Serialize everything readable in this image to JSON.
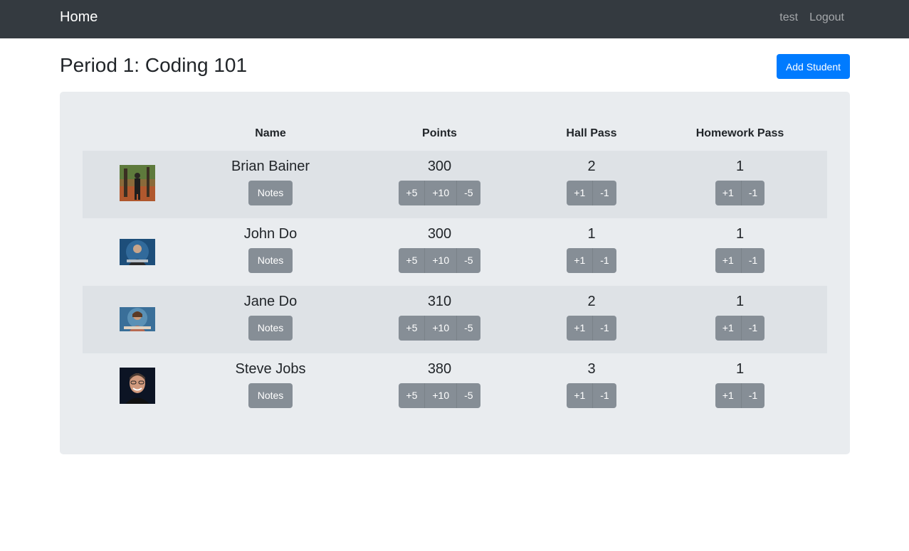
{
  "navbar": {
    "brand": "Home",
    "user": "test",
    "logout": "Logout"
  },
  "page": {
    "title": "Period 1: Coding 101",
    "add_student": "Add Student"
  },
  "table": {
    "headers": [
      "",
      "Name",
      "Points",
      "Hall Pass",
      "Homework Pass"
    ],
    "students": [
      {
        "name": "Brian Bainer",
        "points": "300",
        "hall_pass": "2",
        "homework_pass": "1",
        "photo": "person-outdoors-photo"
      },
      {
        "name": "John Do",
        "points": "300",
        "hall_pass": "1",
        "homework_pass": "1",
        "photo": "child-blue-background-photo"
      },
      {
        "name": "Jane Do",
        "points": "310",
        "hall_pass": "2",
        "homework_pass": "1",
        "photo": "child-blue-background-photo"
      },
      {
        "name": "Steve Jobs",
        "points": "380",
        "hall_pass": "3",
        "homework_pass": "1",
        "photo": "man-portrait-photo"
      }
    ],
    "notes_label": "Notes",
    "points_buttons": [
      "+5",
      "+10",
      "-5"
    ],
    "pass_buttons": [
      "+1",
      "-1"
    ]
  }
}
